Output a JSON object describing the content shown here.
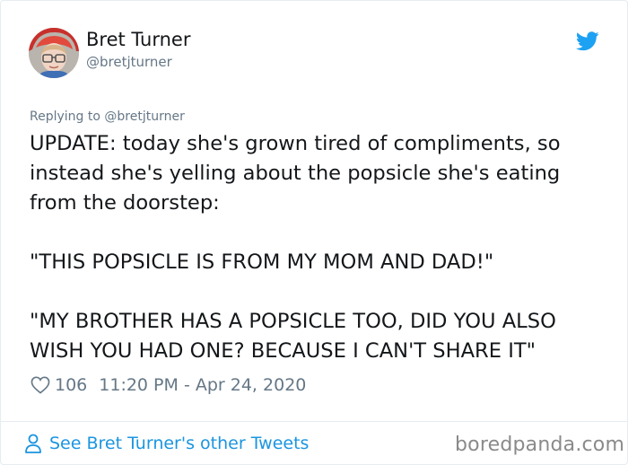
{
  "tweet": {
    "author": {
      "name": "Bret Turner",
      "handle": "@bretjturner"
    },
    "replying_prefix": "Replying to ",
    "replying_to": "@bretjturner",
    "lines": [
      "UPDATE: today she's grown tired of compliments, so",
      "instead she's yelling about the popsicle she's eating",
      "from the doorstep:",
      "",
      "\"THIS POPSICLE IS FROM MY MOM AND DAD!\"",
      "",
      "\"MY BROTHER HAS A POPSICLE TOO, DID YOU ALSO",
      "WISH YOU HAD ONE? BECAUSE I CAN'T SHARE IT\""
    ],
    "likes": "106",
    "timestamp": "11:20 PM - Apr 24, 2020"
  },
  "footer": {
    "see_more": "See Bret Turner's other Tweets"
  },
  "watermark": "boredpanda.com",
  "colors": {
    "link": "#1b95e0",
    "muted": "#657786",
    "text": "#14171a",
    "twitter_blue": "#1da1f2"
  },
  "icons": {
    "brand": "twitter-bird-icon",
    "like": "heart-icon",
    "profile": "person-icon"
  }
}
